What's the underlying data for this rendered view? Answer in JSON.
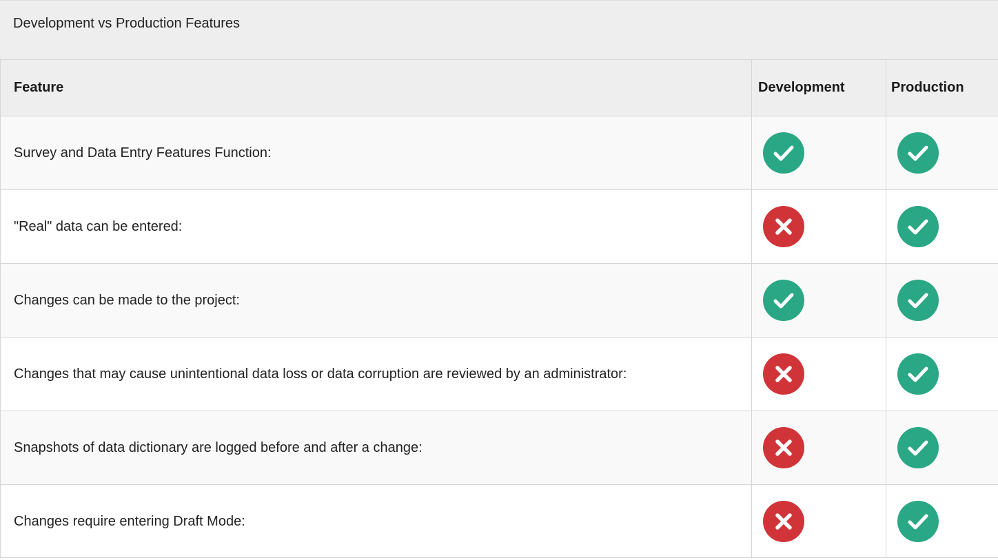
{
  "table": {
    "caption": "Development vs Production Features",
    "headers": {
      "feature": "Feature",
      "development": "Development",
      "production": "Production"
    },
    "rows": [
      {
        "feature": "Survey and Data Entry Features Function:",
        "development": "yes",
        "production": "yes"
      },
      {
        "feature": "\"Real\" data can be entered:",
        "development": "no",
        "production": "yes"
      },
      {
        "feature": "Changes can be made to the project:",
        "development": "yes",
        "production": "yes"
      },
      {
        "feature": "Changes that may cause unintentional data loss or data corruption are reviewed by an administrator:",
        "development": "no",
        "production": "yes"
      },
      {
        "feature": "Snapshots of data dictionary are logged before and after a change:",
        "development": "no",
        "production": "yes"
      },
      {
        "feature": "Changes require entering Draft Mode:",
        "development": "no",
        "production": "yes"
      }
    ]
  },
  "icons": {
    "yes": {
      "name": "check-circle-icon",
      "color": "#2aa784"
    },
    "no": {
      "name": "x-circle-icon",
      "color": "#d13438"
    }
  }
}
